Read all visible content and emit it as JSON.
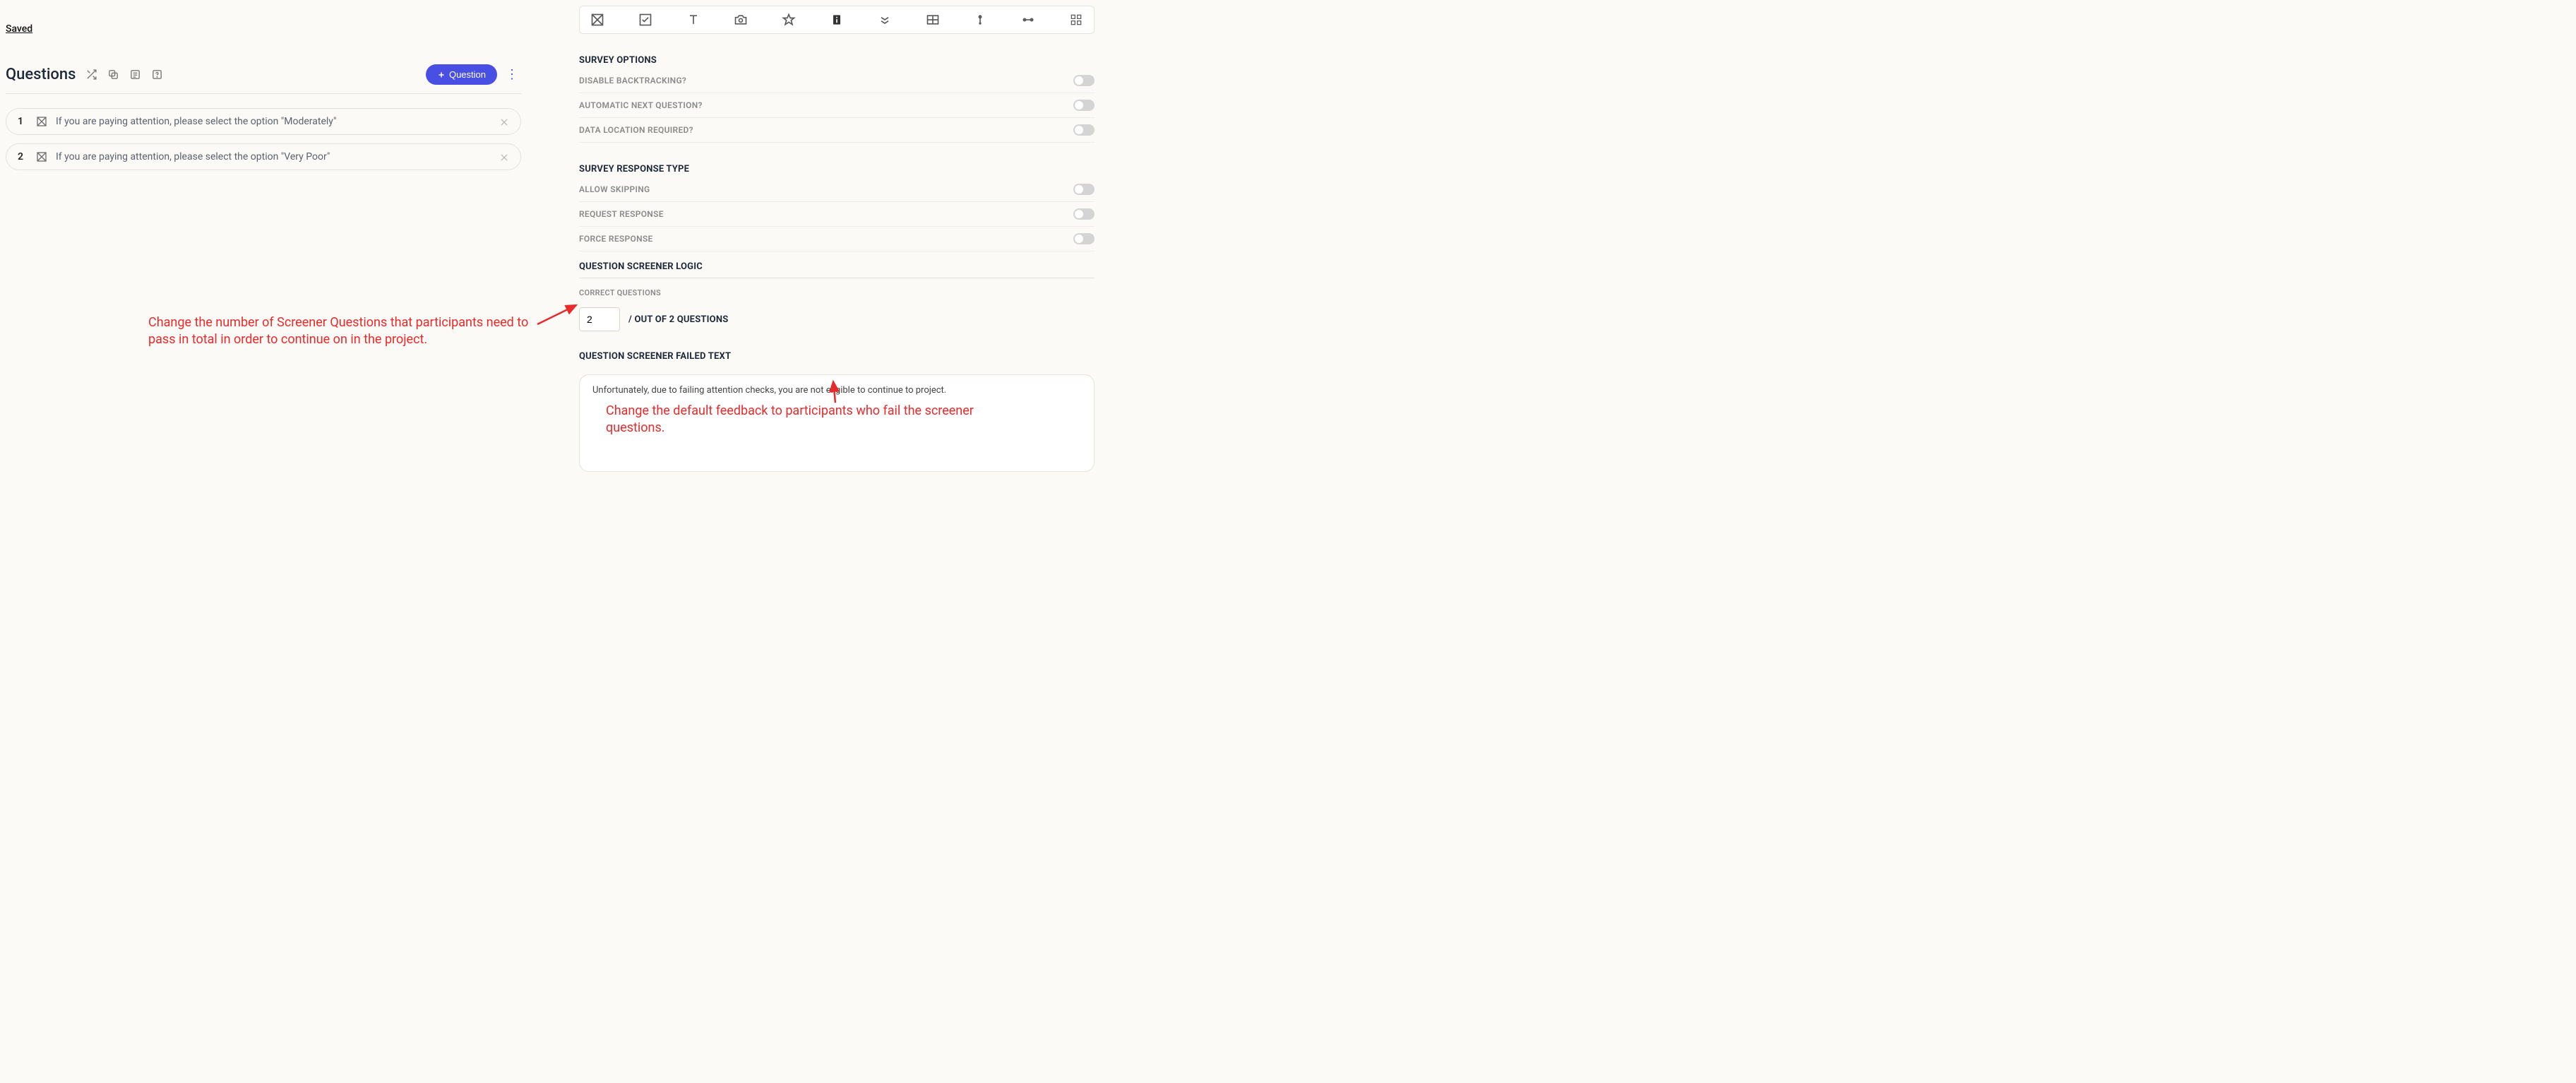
{
  "saved_label": "Saved",
  "questions_header": {
    "title": "Questions",
    "add_button_label": "Question"
  },
  "questions": [
    {
      "num": "1",
      "text": "If you are paying attention, please select the option \"Moderately\""
    },
    {
      "num": "2",
      "text": "If you are paying attention, please select the option \"Very Poor\""
    }
  ],
  "survey_options": {
    "heading": "SURVEY OPTIONS",
    "items": {
      "disable_backtracking": "DISABLE BACKTRACKING?",
      "automatic_next": "AUTOMATIC NEXT QUESTION?",
      "data_location": "DATA LOCATION REQUIRED?"
    }
  },
  "survey_response": {
    "heading": "SURVEY RESPONSE TYPE",
    "items": {
      "allow_skipping": "ALLOW SKIPPING",
      "request_response": "REQUEST RESPONSE",
      "force_response": "FORCE RESPONSE"
    }
  },
  "screener_logic": {
    "heading": "QUESTION SCREENER LOGIC",
    "correct_label": "CORRECT QUESTIONS",
    "correct_value": "2",
    "out_of_text": "/ OUT OF 2 QUESTIONS"
  },
  "screener_failed": {
    "heading": "QUESTION SCREENER FAILED TEXT",
    "text": "Unfortunately, due to failing attention checks, you are not eligible to continue to project."
  },
  "annotations": {
    "a1": "Change the number of Screener Questions that participants need to pass in total in order to continue on in the project.",
    "a2": "Change the default feedback to participants who fail the screener questions."
  }
}
